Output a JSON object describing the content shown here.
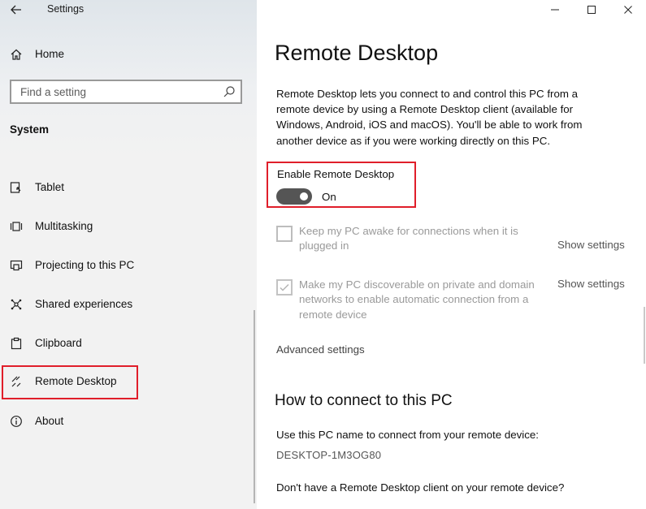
{
  "window": {
    "title": "Settings",
    "controls": {
      "minimize": "minimize-icon",
      "maximize": "maximize-icon",
      "close": "close-icon"
    }
  },
  "sidebar": {
    "home": {
      "label": "Home",
      "icon": "home-icon"
    },
    "search": {
      "placeholder": "Find a setting",
      "icon": "search-icon"
    },
    "section": "System",
    "items": [
      {
        "label": "Tablet",
        "icon": "tablet-icon"
      },
      {
        "label": "Multitasking",
        "icon": "multitasking-icon"
      },
      {
        "label": "Projecting to this PC",
        "icon": "projecting-icon"
      },
      {
        "label": "Shared experiences",
        "icon": "shared-experiences-icon"
      },
      {
        "label": "Clipboard",
        "icon": "clipboard-icon"
      },
      {
        "label": "Remote Desktop",
        "icon": "remote-desktop-icon",
        "selected": true
      },
      {
        "label": "About",
        "icon": "info-icon"
      }
    ]
  },
  "main": {
    "title": "Remote Desktop",
    "description": "Remote Desktop lets you connect to and control this PC from a remote device by using a Remote Desktop client (available for Windows, Android, iOS and macOS). You'll be able to work from another device as if you were working directly on this PC.",
    "enable": {
      "label": "Enable Remote Desktop",
      "state": "On",
      "on": true
    },
    "options": [
      {
        "text": "Keep my PC awake for connections when it is plugged in",
        "checked": false,
        "link": "Show settings"
      },
      {
        "text": "Make my PC discoverable on private and domain networks to enable automatic connection from a remote device",
        "checked": true,
        "link": "Show settings"
      }
    ],
    "advanced": "Advanced settings",
    "connect": {
      "heading": "How to connect to this PC",
      "instruction": "Use this PC name to connect from your remote device:",
      "pc_name": "DESKTOP-1M3OG80",
      "no_client": "Don't have a Remote Desktop client on your remote device?"
    }
  },
  "colors": {
    "highlight": "#e01e2a",
    "toggle_on": "#555555",
    "sidebar_bg": "#f2f2f2"
  }
}
